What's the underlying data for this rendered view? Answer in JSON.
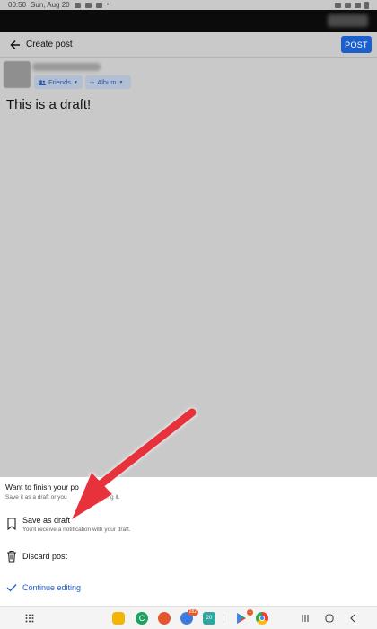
{
  "status_bar": {
    "time": "00:50",
    "date": "Sun, Aug 20"
  },
  "header": {
    "title": "Create post",
    "post_label": "POST"
  },
  "composer": {
    "audience_label": "Friends",
    "album_label": "Album",
    "post_text": "This is a draft!"
  },
  "sheet": {
    "title": "Want to finish your po",
    "subtitle": "Save it as a draft or you",
    "subtitle_tail": "ue editing it.",
    "options": [
      {
        "label": "Save as draft",
        "sub": "You'll receive a notification with your draft.",
        "icon": "bookmark-icon"
      },
      {
        "label": "Discard post",
        "icon": "trash-icon"
      },
      {
        "label": "Continue editing",
        "icon": "check-icon"
      }
    ]
  },
  "nav_bar": {
    "apps": [
      {
        "name": "apps-grid-icon"
      },
      {
        "name": "folder-app",
        "color": "#f5b400"
      },
      {
        "name": "phone-app",
        "color": "#1aa260"
      },
      {
        "name": "contacts-app",
        "color": "#e4572e"
      },
      {
        "name": "messages-app",
        "color": "#3d7be0",
        "badge": "282"
      },
      {
        "name": "calendar-app",
        "color": "#2fa7a0",
        "text": "20"
      },
      {
        "name": "play-store-app",
        "badge": "1"
      },
      {
        "name": "chrome-app"
      }
    ],
    "system": [
      "recents-button",
      "home-button",
      "back-button"
    ]
  },
  "colors": {
    "accent": "#1b5fcc",
    "annotation_arrow": "#e8313a"
  }
}
